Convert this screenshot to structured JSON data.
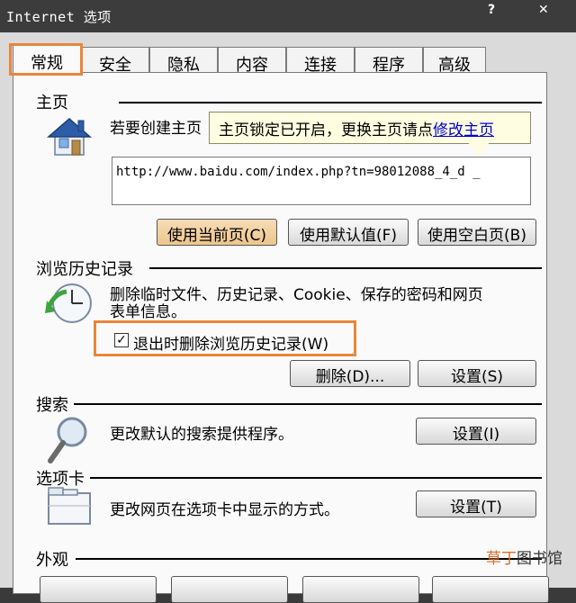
{
  "window": {
    "title": "Internet 选项",
    "help_icon": "?",
    "close_icon": "✕"
  },
  "tabs": [
    "常规",
    "安全",
    "隐私",
    "内容",
    "连接",
    "程序",
    "高级"
  ],
  "home": {
    "label": "主页",
    "desc": "若要创建主页",
    "url": "http://www.baidu.com/index.php?tn=98012088_4_d _",
    "tooltip_text": "主页锁定已开启，更换主页请点",
    "tooltip_link": "修改主页",
    "buttons": [
      "使用当前页(C)",
      "使用默认值(F)",
      "使用空白页(B)"
    ]
  },
  "history": {
    "label": "浏览历史记录",
    "desc_line1": "删除临时文件、历史记录、Cookie、保存的密码和网页",
    "desc_line2": "表单信息。",
    "checkbox_label": "退出时删除浏览历史记录(W)",
    "checkbox_checked": true,
    "checkbox_mark": "✓",
    "delete_button": "删除(D)...",
    "settings_button": "设置(S)"
  },
  "search": {
    "label": "搜索",
    "desc": "更改默认的搜索提供程序。",
    "settings_button": "设置(I)"
  },
  "tabs_section": {
    "label": "选项卡",
    "desc": "更改网页在选项卡中显示的方式。",
    "settings_button": "设置(T)"
  },
  "appearance": {
    "label": "外观"
  },
  "watermark": {
    "red": "草丁",
    "gray": "图书馆"
  },
  "colors": {
    "highlight": "#e9863a",
    "link": "#0000d0",
    "tooltip_bg": "#fffde1"
  }
}
